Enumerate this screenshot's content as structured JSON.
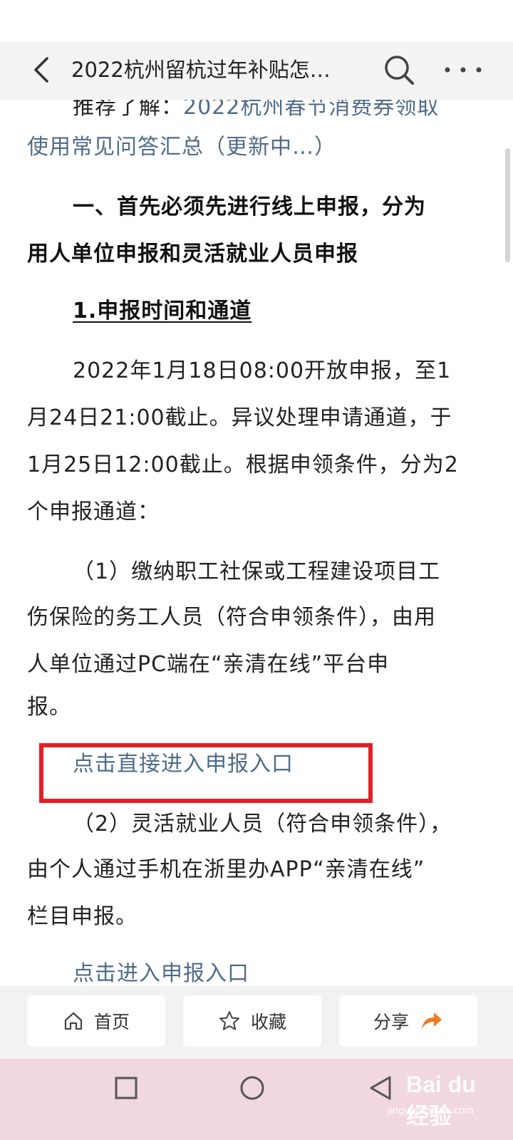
{
  "header": {
    "title": "2022杭州留杭过年补贴怎…"
  },
  "article": {
    "rec_prefix": "推荐了解：",
    "rec_link_line1": "2022杭州春节消费券领取",
    "rec_link_line2": "使用常见问答汇总（更新中…）",
    "heading1_line1": "一、首先必须先进行线上申报，分为",
    "heading1_line2": "用人单位申报和灵活就业人员申报",
    "subheading": "1.申报时间和通道",
    "para1_line1": "2022年1月18日08:00开放申报，至1",
    "para1_line2": "月24日21:00截止。异议处理申请通道，于",
    "para1_line3": "1月25日12:00截止。根据申领条件，分为2",
    "para1_line4": "个申报通道：",
    "item1_line1": "（1）缴纳职工社保或工程建设项目工",
    "item1_line2": "伤保险的务工人员（符合申领条件），由用",
    "item1_line3": "人单位通过PC端在“亲清在线”平台申",
    "item1_line4": "报。",
    "link1": "点击直接进入申报入口",
    "item2_line1": "（2）灵活就业人员（符合申领条件），",
    "item2_line2": "由个人通过手机在浙里办APP“亲清在线”",
    "item2_line3": "栏目申报。",
    "link2": "点击进入申报入口"
  },
  "bottom_bar": {
    "home_label": "首页",
    "favorite_label": "收藏",
    "share_label": "分享"
  },
  "watermark": {
    "brand": "Bai du 经验",
    "url": "jingyan.baidu.com"
  },
  "colors": {
    "link": "#4f6b89",
    "highlight_border": "#e0212b",
    "share_arrow": "#f07a1e",
    "nav_bar": "#f1d7de"
  }
}
